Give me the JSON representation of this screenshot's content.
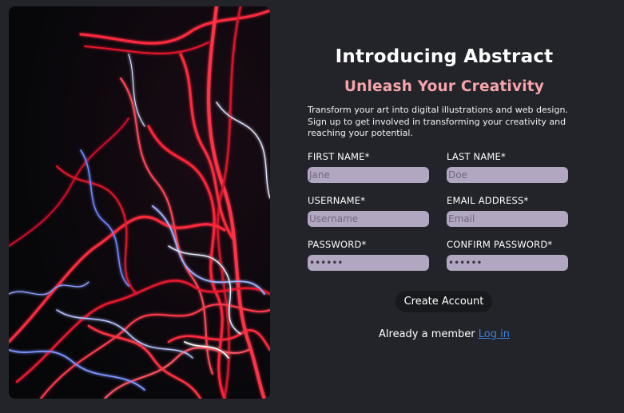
{
  "hero": {
    "alt": "abstract light trails artwork"
  },
  "heading": {
    "title": "Introducing Abstract",
    "subtitle": "Unleash Your Creativity",
    "description": "Transform your art into digital illustrations and web design. Sign up to get involved in transforming your creativity and reaching your potential."
  },
  "form": {
    "first_name": {
      "label": "FIRST NAME*",
      "placeholder": "Jane",
      "value": ""
    },
    "last_name": {
      "label": "LAST NAME*",
      "placeholder": "Doe",
      "value": ""
    },
    "username": {
      "label": "USERNAME*",
      "placeholder": "Username",
      "value": ""
    },
    "email": {
      "label": "EMAIL ADDRESS*",
      "placeholder": "Email",
      "value": ""
    },
    "password": {
      "label": "PASSWORD*",
      "value": "secret"
    },
    "confirm_password": {
      "label": "CONFIRM PASSWORD*",
      "value": "secret"
    },
    "submit_label": "Create Account"
  },
  "footer": {
    "member_text": "Already a member",
    "login_link": "Log in"
  },
  "colors": {
    "background": "#232429",
    "accent": "#f5a4ab",
    "input_fill": "#b2a7c0",
    "button_fill": "#18191c",
    "link": "#3d7fe0"
  }
}
